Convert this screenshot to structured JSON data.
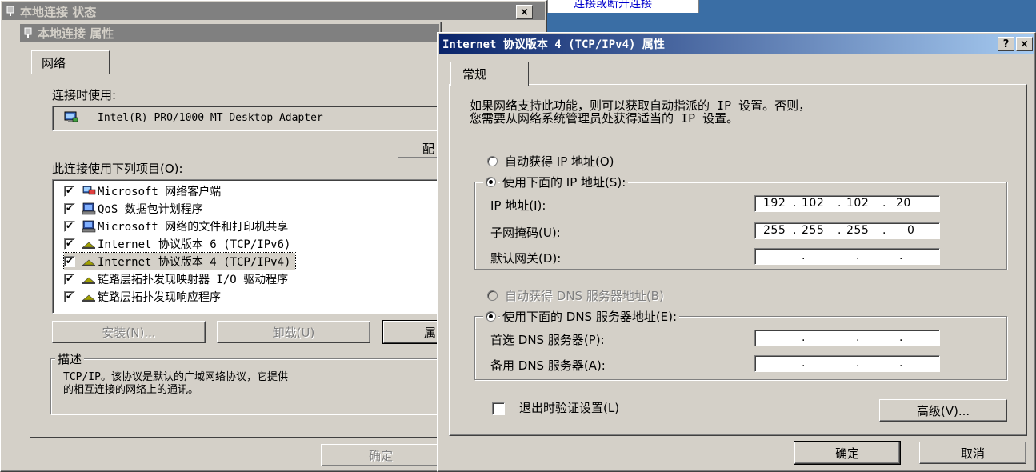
{
  "colors": {
    "desktop": "#3a6ea5",
    "active_title_from": "#0a246a",
    "active_title_to": "#a6caf0",
    "inactive_title": "#808080"
  },
  "background_window": {
    "title": "本地连接 状态",
    "hint_popup_text": "连接或断开连接"
  },
  "props_window": {
    "title": "本地连接 属性",
    "tab": "网络",
    "connect_using_label": "连接时使用:",
    "adapter_name": "Intel(R) PRO/1000 MT Desktop Adapter",
    "configure_button": "配",
    "items_label": "此连接使用下列项目(O):",
    "items": [
      {
        "label": "Microsoft 网络客户端",
        "checked": true,
        "icon": "network-client-icon"
      },
      {
        "label": "QoS 数据包计划程序",
        "checked": true,
        "icon": "qos-scheduler-icon"
      },
      {
        "label": "Microsoft 网络的文件和打印机共享",
        "checked": true,
        "icon": "file-printer-sharing-icon"
      },
      {
        "label": "Internet 协议版本 6 (TCP/IPv6)",
        "checked": true,
        "icon": "protocol-icon"
      },
      {
        "label": "Internet 协议版本 4 (TCP/IPv4)",
        "checked": true,
        "icon": "protocol-icon",
        "selected": true
      },
      {
        "label": "链路层拓扑发现映射器 I/O 驱动程序",
        "checked": true,
        "icon": "protocol-icon"
      },
      {
        "label": "链路层拓扑发现响应程序",
        "checked": true,
        "icon": "protocol-icon"
      }
    ],
    "install_button": "安装(N)...",
    "uninstall_button": "卸载(U)",
    "properties_button": "属",
    "description_legend": "描述",
    "description_text_1": "TCP/IP。该协议是默认的广域网络协议，它提供",
    "description_text_2": "的相互连接的网络上的通讯。",
    "ok_button": "确定"
  },
  "ipv4_window": {
    "title": "Internet 协议版本 4 (TCP/IPv4) 属性",
    "help_button": "?",
    "close_button": "×",
    "tab": "常规",
    "intro_line_1": "如果网络支持此功能，则可以获取自动指派的 IP 设置。否则，",
    "intro_line_2": "您需要从网络系统管理员处获得适当的 IP 设置。",
    "auto_ip_label": "自动获得 IP 地址(O)",
    "manual_ip_label": "使用下面的 IP 地址(S):",
    "ip_address_label": "IP 地址(I):",
    "ip_address": [
      "192",
      "102",
      "102",
      "20"
    ],
    "subnet_label": "子网掩码(U):",
    "subnet_mask": [
      "255",
      "255",
      "255",
      "0"
    ],
    "gateway_label": "默认网关(D):",
    "gateway": [
      "",
      "",
      "",
      ""
    ],
    "auto_dns_label": "自动获得 DNS 服务器地址(B)",
    "manual_dns_label": "使用下面的 DNS 服务器地址(E):",
    "preferred_dns_label": "首选 DNS 服务器(P):",
    "alternate_dns_label": "备用 DNS 服务器(A):",
    "validate_label": "退出时验证设置(L)",
    "validate_checked": false,
    "advanced_button": "高级(V)...",
    "ok_button": "确定",
    "cancel_button": "取消",
    "mode_ip": "manual",
    "mode_dns": "manual"
  }
}
